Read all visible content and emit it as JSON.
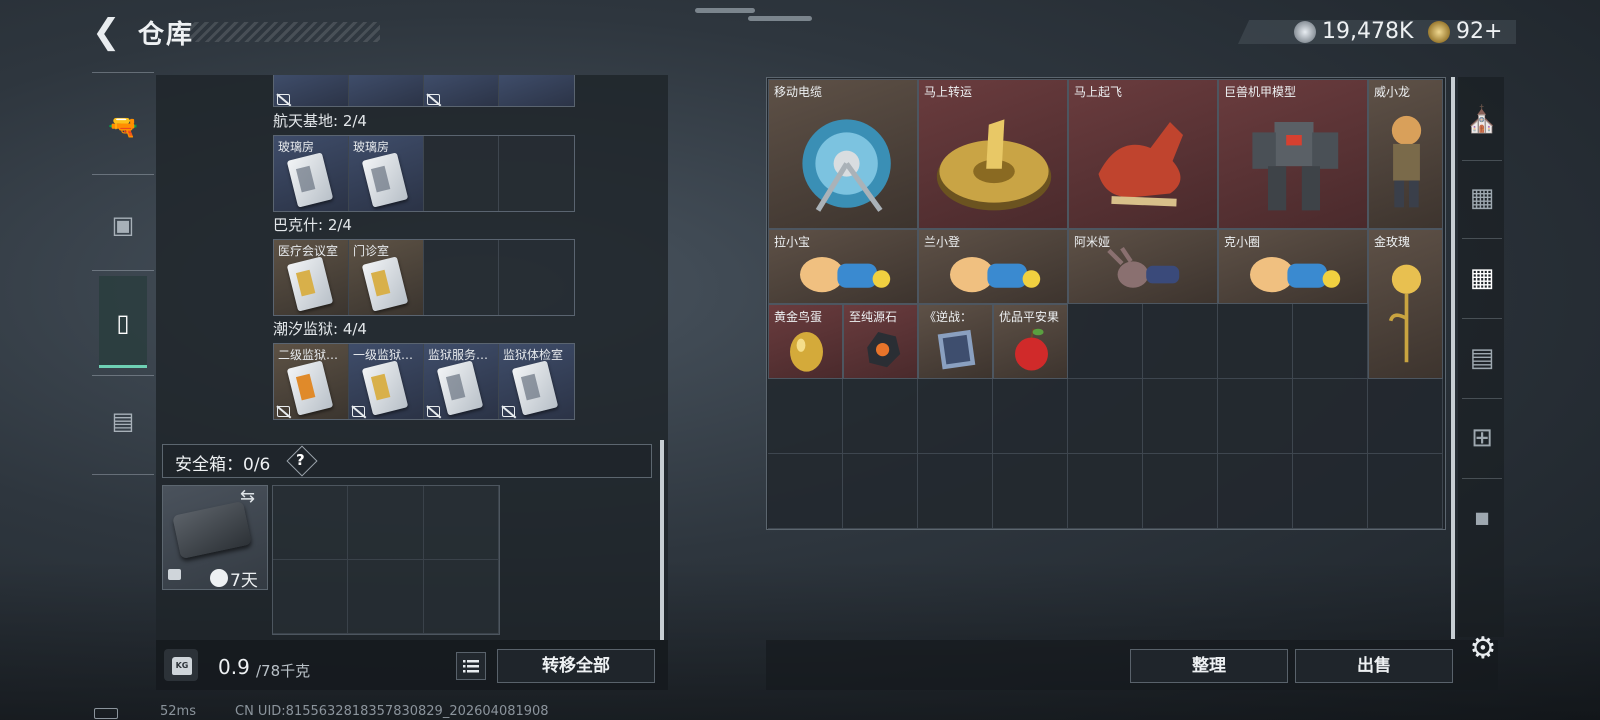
{
  "header": {
    "back_icon": "back-arrow-icon",
    "title": "仓库",
    "silver_value": "19,478K",
    "gold_value": "92",
    "gold_plus": "+"
  },
  "left_nav": [
    {
      "name": "weapons",
      "icon": "gun-icon",
      "active": false
    },
    {
      "name": "equipment",
      "icon": "vest-icon",
      "active": false
    },
    {
      "name": "backpack",
      "icon": "backpack-icon",
      "active": true
    },
    {
      "name": "toolbox",
      "icon": "toolbox-icon",
      "active": false
    }
  ],
  "sections": [
    {
      "title": "航天基地: 2/4",
      "items": [
        {
          "name": "玻璃房",
          "color": "blue",
          "badge": false
        },
        {
          "name": "玻璃房",
          "color": "blue",
          "badge": false
        },
        {
          "name": "",
          "color": "empty",
          "badge": false
        },
        {
          "name": "",
          "color": "empty",
          "badge": false
        }
      ]
    },
    {
      "title": "巴克什: 2/4",
      "items": [
        {
          "name": "医疗会议室",
          "color": "brown",
          "badge": false
        },
        {
          "name": "门诊室",
          "color": "brown",
          "badge": false
        },
        {
          "name": "",
          "color": "empty",
          "badge": false
        },
        {
          "name": "",
          "color": "empty",
          "badge": false
        }
      ]
    },
    {
      "title": "潮汐监狱: 4/4",
      "items": [
        {
          "name": "二级监狱…",
          "color": "brown",
          "badge": true
        },
        {
          "name": "一级监狱…",
          "color": "blue",
          "badge": true
        },
        {
          "name": "监狱服务…",
          "color": "blue",
          "badge": true
        },
        {
          "name": "监狱体检室",
          "color": "blue",
          "badge": true
        }
      ]
    }
  ],
  "safe_box": {
    "label": "安全箱：0/6",
    "help": "?",
    "duration": "7天"
  },
  "weight": {
    "current": "0.9",
    "max": "/78千克"
  },
  "buttons": {
    "transfer_all": "转移全部",
    "sort": "整理",
    "sell": "出售"
  },
  "stash_items": [
    {
      "name": "移动电缆",
      "bg": "brown",
      "icon": "cable-reel-icon"
    },
    {
      "name": "马上转运",
      "bg": "red",
      "icon": "gold-medallion-icon"
    },
    {
      "name": "马上起飞",
      "bg": "red",
      "icon": "red-horse-icon"
    },
    {
      "name": "巨兽机甲模型",
      "bg": "red",
      "icon": "mech-model-icon"
    },
    {
      "name": "威小龙",
      "bg": "brown",
      "icon": "soldier-figure-icon"
    },
    {
      "name": "拉小宝",
      "bg": "brown",
      "icon": "plush-doll-icon"
    },
    {
      "name": "兰小登",
      "bg": "brown",
      "icon": "plush-doll-icon"
    },
    {
      "name": "阿米娅",
      "bg": "brown",
      "icon": "bunny-doll-icon"
    },
    {
      "name": "克小圈",
      "bg": "brown",
      "icon": "plush-doll-icon"
    },
    {
      "name": "金玫瑰",
      "bg": "brown",
      "icon": "gold-rose-icon"
    },
    {
      "name": "黄金鸟蛋",
      "bg": "red",
      "icon": "gold-egg-icon"
    },
    {
      "name": "至纯源石",
      "bg": "red",
      "icon": "ore-stone-icon"
    },
    {
      "name": "《逆战：",
      "bg": "brown",
      "icon": "game-box-icon"
    },
    {
      "name": "优品平安果",
      "bg": "brown",
      "icon": "apple-icon"
    }
  ],
  "right_nav": [
    {
      "name": "stash-main",
      "icon": "vault-icon",
      "active": false
    },
    {
      "name": "stash-1",
      "icon": "stash-tab-1-icon",
      "active": false
    },
    {
      "name": "stash-2",
      "icon": "stash-tab-2-icon",
      "active": true
    },
    {
      "name": "stash-3",
      "icon": "stash-tab-3-icon",
      "active": false
    },
    {
      "name": "stash-add",
      "icon": "add-stash-icon",
      "active": false
    },
    {
      "name": "stash-locked",
      "icon": "lock-icon",
      "active": false
    }
  ],
  "status_bar": {
    "ping": "52ms",
    "uid": "CN UID:8155632818357830829_202604081908"
  }
}
